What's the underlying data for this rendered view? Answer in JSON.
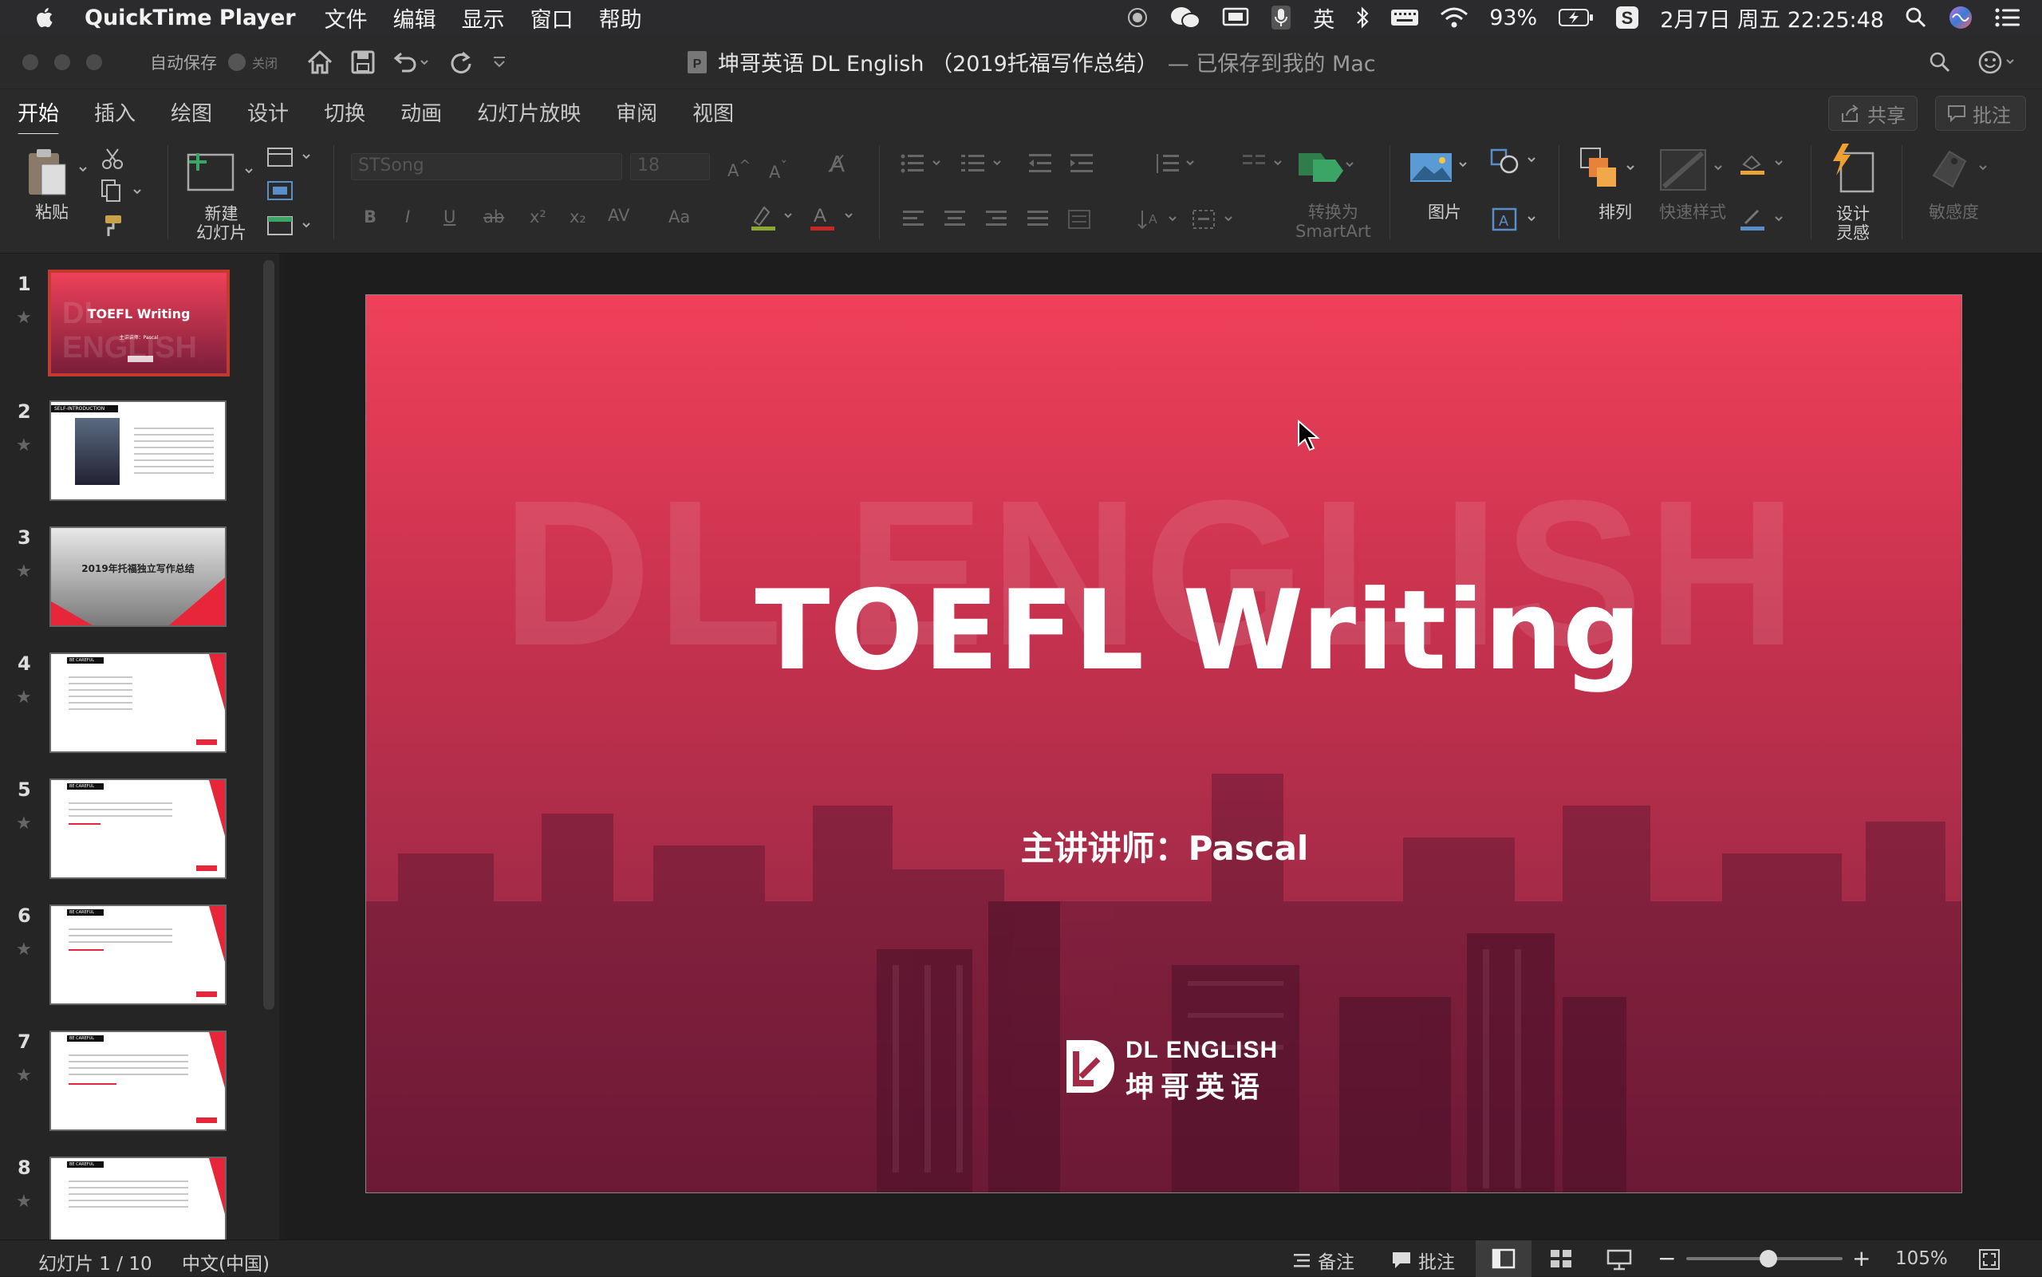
{
  "menubar": {
    "app": "QuickTime Player",
    "menus": [
      "文件",
      "编辑",
      "显示",
      "窗口",
      "帮助"
    ],
    "battery": "93%",
    "input_method": "英",
    "clock": "2月7日 周五  22:25:48"
  },
  "titlebar": {
    "autosave_label": "自动保存",
    "toggle_label": "关闭",
    "doc_title": "坤哥英语 DL English （2019托福写作总结）",
    "saved_status": "— 已保存到我的 Mac"
  },
  "tabs": [
    "开始",
    "插入",
    "绘图",
    "设计",
    "切换",
    "动画",
    "幻灯片放映",
    "审阅",
    "视图"
  ],
  "share": {
    "share_label": "共享",
    "comments_label": "批注"
  },
  "ribbon": {
    "paste": "粘贴",
    "new_slide_1": "新建",
    "new_slide_2": "幻灯片",
    "font_name": "STSong",
    "font_size": "18",
    "smartart_1": "转换为",
    "smartart_2": "SmartArt",
    "picture": "图片",
    "arrange": "排列",
    "quick_styles": "快速样式",
    "design_ideas_1": "设计",
    "design_ideas_2": "灵感",
    "sensitivity": "敏感度"
  },
  "thumbnails": [
    {
      "num": "1",
      "title": "TOEFL Writing",
      "sub": "主讲讲师：Pascal"
    },
    {
      "num": "2",
      "title": "SELF-INTRODUCTION",
      "sub": ""
    },
    {
      "num": "3",
      "title": "2019年托福独立写作总结",
      "sub": ""
    },
    {
      "num": "4",
      "title": "BE CAREFUL",
      "sub": ""
    },
    {
      "num": "5",
      "title": "BE CAREFUL",
      "sub": ""
    },
    {
      "num": "6",
      "title": "BE CAREFUL",
      "sub": ""
    },
    {
      "num": "7",
      "title": "BE CAREFUL",
      "sub": ""
    },
    {
      "num": "8",
      "title": "BE CAREFUL",
      "sub": ""
    }
  ],
  "slide": {
    "watermark": "DL ENGLISH",
    "title": "TOEFL Writing",
    "presenter": "主讲讲师：Pascal",
    "logo_en": "DL ENGLISH",
    "logo_cn": "坤哥英语"
  },
  "status": {
    "slide_counter": "幻灯片 1 / 10",
    "language": "中文(中国)",
    "notes": "备注",
    "comments": "批注",
    "zoom": "105%"
  },
  "colors": {
    "slide_top": "#f0405a",
    "slide_bottom": "#7a1e3a",
    "selection": "#c33b2f",
    "thumb_red": "#e8263a"
  }
}
